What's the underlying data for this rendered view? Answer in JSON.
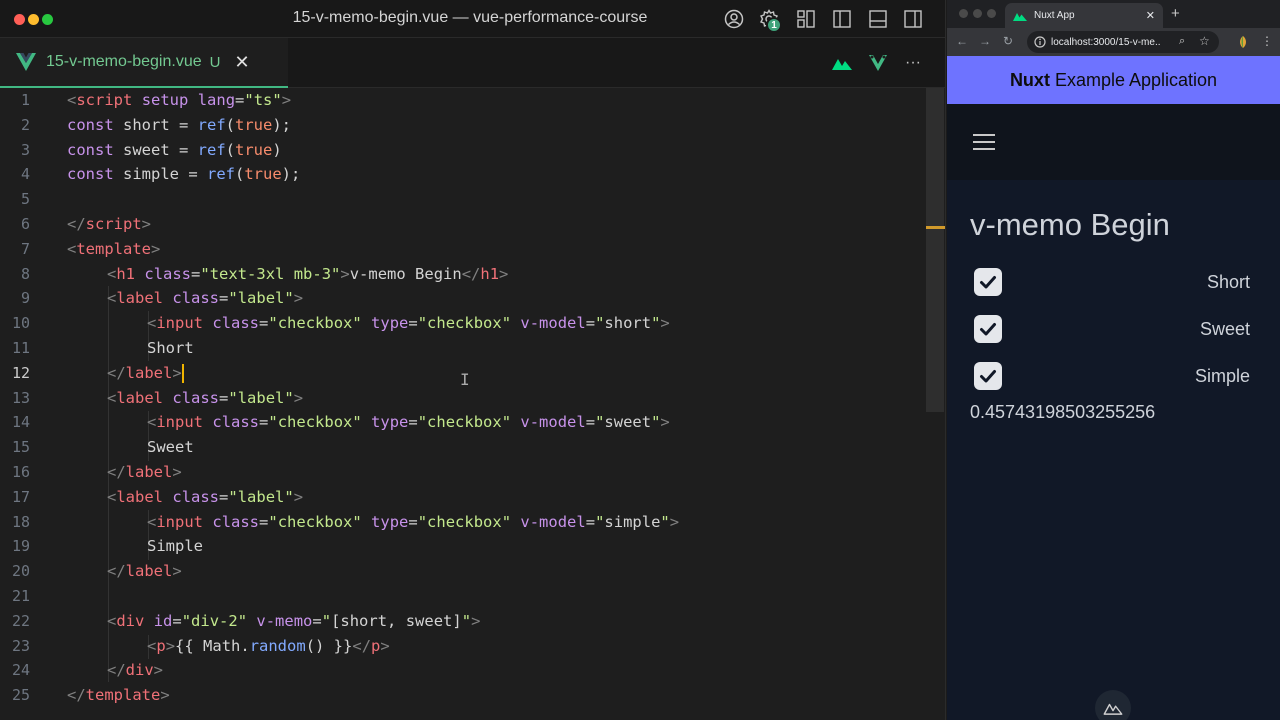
{
  "vscode": {
    "window_title": "15-v-memo-begin.vue — vue-performance-course",
    "notification_badge": "1",
    "tab": {
      "file_name": "15-v-memo-begin.vue",
      "status": "U",
      "close": "✕"
    },
    "more_actions": "···",
    "active_line": 12,
    "line_numbers": [
      "1",
      "2",
      "3",
      "4",
      "5",
      "6",
      "7",
      "8",
      "9",
      "10",
      "11",
      "12",
      "13",
      "14",
      "15",
      "16",
      "17",
      "18",
      "19",
      "20",
      "21",
      "22",
      "23",
      "24",
      "25"
    ]
  },
  "code": {
    "l1": [
      "<",
      "script",
      " ",
      "setup",
      " ",
      "lang",
      "=",
      "\"ts\"",
      ">"
    ],
    "l2": [
      "const",
      " short = ",
      "ref",
      "(",
      "true",
      ");"
    ],
    "l3": [
      "const",
      " sweet = ",
      "ref",
      "(",
      "true",
      ")"
    ],
    "l4": [
      "const",
      " simple = ",
      "ref",
      "(",
      "true",
      ");"
    ],
    "l6": [
      "</",
      "script",
      ">"
    ],
    "l7": [
      "<",
      "template",
      ">"
    ],
    "l8": [
      "<",
      "h1",
      " ",
      "class",
      "=",
      "\"text-3xl mb-3\"",
      ">",
      "v-memo Begin",
      "</",
      "h1",
      ">"
    ],
    "l9": [
      "<",
      "label",
      " ",
      "class",
      "=",
      "\"label\"",
      ">"
    ],
    "l10": [
      "<",
      "input",
      " ",
      "class",
      "=",
      "\"checkbox\"",
      " ",
      "type",
      "=",
      "\"checkbox\"",
      " ",
      "v-model",
      "=",
      "\"",
      "short",
      "\"",
      ">"
    ],
    "l11": [
      "Short"
    ],
    "l12": [
      "</",
      "label",
      ">"
    ],
    "l13": [
      "<",
      "label",
      " ",
      "class",
      "=",
      "\"label\"",
      ">"
    ],
    "l14": [
      "<",
      "input",
      " ",
      "class",
      "=",
      "\"checkbox\"",
      " ",
      "type",
      "=",
      "\"checkbox\"",
      " ",
      "v-model",
      "=",
      "\"",
      "sweet",
      "\"",
      ">"
    ],
    "l15": [
      "Sweet"
    ],
    "l16": [
      "</",
      "label",
      ">"
    ],
    "l17": [
      "<",
      "label",
      " ",
      "class",
      "=",
      "\"label\"",
      ">"
    ],
    "l18": [
      "<",
      "input",
      " ",
      "class",
      "=",
      "\"checkbox\"",
      " ",
      "type",
      "=",
      "\"checkbox\"",
      " ",
      "v-model",
      "=",
      "\"",
      "simple",
      "\"",
      ">"
    ],
    "l19": [
      "Simple"
    ],
    "l20": [
      "</",
      "label",
      ">"
    ],
    "l22": [
      "<",
      "div",
      " ",
      "id",
      "=",
      "\"div-2\"",
      " ",
      "v-memo",
      "=",
      "\"",
      "[short, sweet]",
      "\"",
      ">"
    ],
    "l23": [
      "<",
      "p",
      ">",
      "{{ Math.",
      "random",
      "() }}",
      "</",
      "p",
      ">"
    ],
    "l24": [
      "</",
      "div",
      ">"
    ],
    "l25": [
      "</",
      "template",
      ">"
    ]
  },
  "browser": {
    "tab_title": "Nuxt App",
    "tab_close": "✕",
    "new_tab": "+",
    "url": "localhost:3000/15-v-me...",
    "app_header_bold": "Nuxt",
    "app_header_rest": " Example Application",
    "page_heading": "v-memo Begin",
    "checkboxes": [
      {
        "label": "Short",
        "checked": true
      },
      {
        "label": "Sweet",
        "checked": true
      },
      {
        "label": "Simple",
        "checked": true
      }
    ],
    "random_value": "0.45743198503255256"
  },
  "colors": {
    "vue_green": "#41b883",
    "nuxt_header": "#6e73ff",
    "cursor": "#f0b400"
  },
  "icons": [
    "account-icon",
    "settings-gear-icon",
    "layout-customize-icon",
    "toggle-sidebar-icon",
    "toggle-panel-icon",
    "toggle-secondary-sidebar-icon",
    "vue-file-icon",
    "nuxt-icon",
    "vue-devtools-icon",
    "hamburger-menu-icon",
    "checkmark-icon"
  ]
}
